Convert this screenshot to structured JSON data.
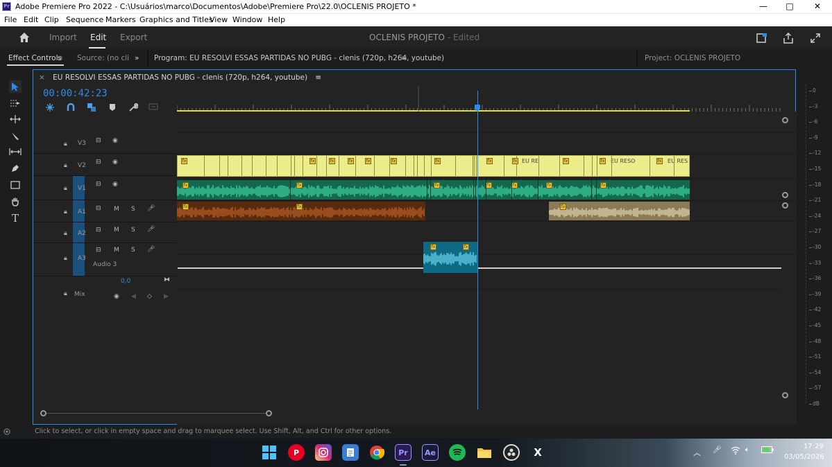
{
  "window": {
    "app_icon": "Pr",
    "title": "Adobe Premiere Pro 2022 - C:\\Usuários\\marco\\Documentos\\Adobe\\Premiere Pro\\22.0\\OCLENIS PROJETO *",
    "minimize": "—",
    "maximize": "□",
    "close": "✕"
  },
  "menu": [
    "File",
    "Edit",
    "Clip",
    "Sequence",
    "Markers",
    "Graphics and Titles",
    "View",
    "Window",
    "Help"
  ],
  "header": {
    "tabs": [
      "Import",
      "Edit",
      "Export"
    ],
    "active_tab": "Edit",
    "project_name": "OCLENIS PROJETO",
    "project_status": "- Edited"
  },
  "panels": {
    "effect_controls": "Effect Controls",
    "source": "Source: (no cli",
    "more": "»",
    "program": "Program: EU RESOLVI ESSAS PARTIDAS NO PUBG - clenis (720p, h264, youtube)",
    "project": "Project: OCLENIS PROJETO",
    "menu_glyph": "≡"
  },
  "timeline": {
    "sequence_tab": "EU RESOLVI ESSAS PARTIDAS NO PUBG - clenis (720p, h264, youtube)",
    "close_glyph": "×",
    "timecode": "00:00:42:23",
    "playhead_fraction": 0.485,
    "tracks": {
      "V3": "V3",
      "V2": "V2",
      "V1": "V1",
      "A1": "A1",
      "A2": "A2",
      "A3": "A3",
      "audio3_name": "Audio 3",
      "mix_label": "Mix",
      "mix_value": "0,0",
      "M": "M",
      "S": "S"
    },
    "clip_labels": {
      "v1_a": "EU RE",
      "v1_b": "EU RESO",
      "v1_c": "EU RES"
    },
    "fx_badge": "fx"
  },
  "meters": {
    "labels": [
      "0",
      "-3",
      "-6",
      "-9",
      "-12",
      "-15",
      "-18",
      "-21",
      "-24",
      "-27",
      "-30",
      "-33",
      "-36",
      "-39",
      "-42",
      "-45",
      "-48",
      "-51",
      "-54",
      "-57",
      "dB"
    ]
  },
  "status": {
    "text": "Click to select, or click in empty space and drag to marquee select. Use Shift, Alt, and Ctrl for other options."
  },
  "taskbar": {
    "time": "17:29",
    "date": "03/05/2026",
    "icons": [
      "windows-icon",
      "pinterest-icon",
      "instagram-icon",
      "notepad-icon",
      "chrome-icon",
      "premiere-icon",
      "after-effects-icon",
      "spotify-icon",
      "file-explorer-icon",
      "obs-icon",
      "x-icon"
    ],
    "premiere_label": "Pr",
    "ae_label": "Ae",
    "x_label": "X"
  },
  "colors": {
    "accent_blue": "#2d8ceb",
    "video_clip": "#ecec8a",
    "audio_green": "#1fb58a",
    "audio_brown": "#8b4a1e",
    "audio_tan": "#c8b88a",
    "audio_cyan": "#2aa8c8"
  }
}
